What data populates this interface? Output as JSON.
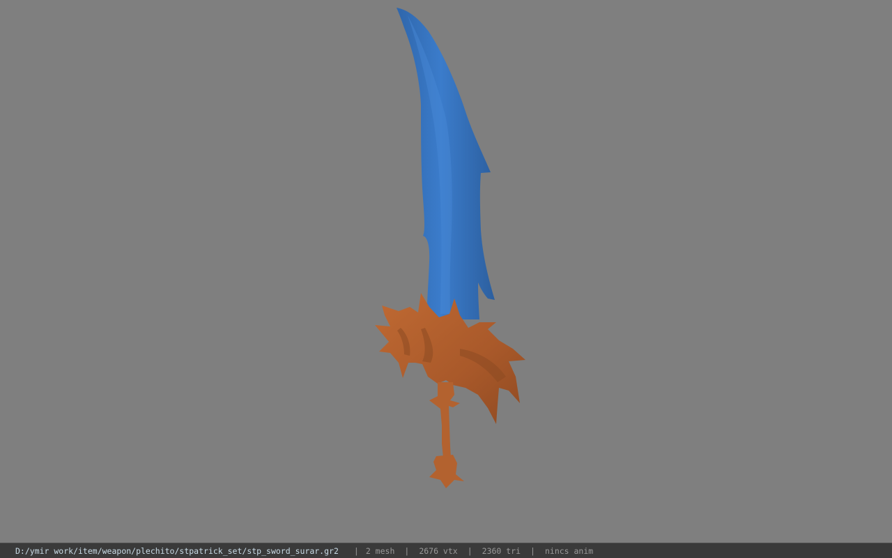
{
  "viewport": {
    "background_color": "#7f7f7f",
    "model": {
      "blade_color": "#3a78c3",
      "hilt_color": "#b3622f"
    }
  },
  "status_bar": {
    "file_path": "D:/ymir work/item/weapon/plechito/stpatrick_set/stp_sword_surar.gr2",
    "separator": "|",
    "mesh_count": "2 mesh",
    "vertex_count": "2676 vtx",
    "triangle_count": "2360 tri",
    "anim_status": "nincs anim"
  }
}
